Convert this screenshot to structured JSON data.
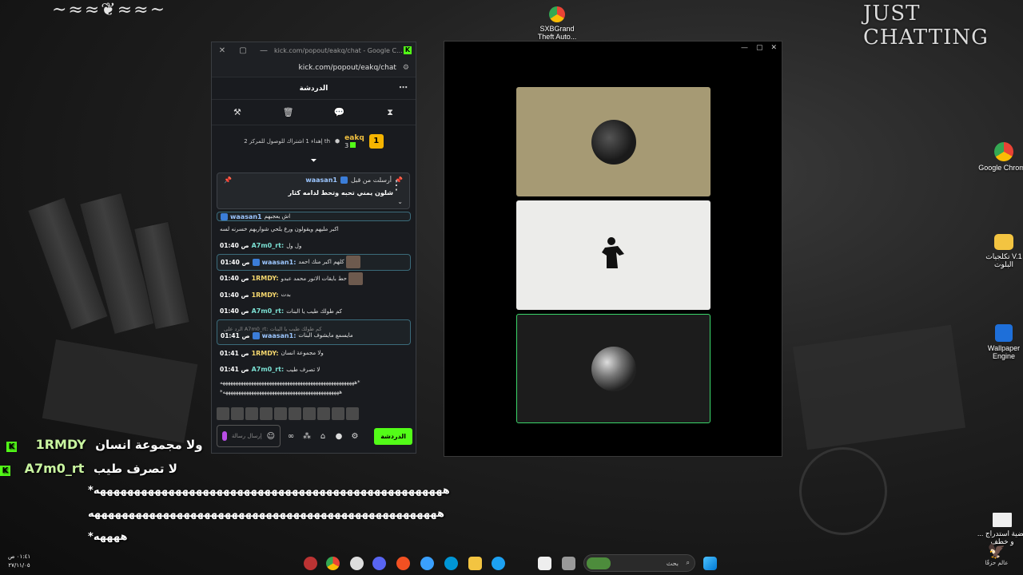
{
  "desktop": {
    "ornament": "~≈≈❦≈≈~",
    "stream_title": "JUST CHATTING",
    "icons": [
      {
        "label": "SXBGrand Theft Auto...",
        "icon": "chrome-shortcut-icon"
      },
      {
        "label": "Google Chrome",
        "icon": "chrome-icon"
      },
      {
        "label": "تكلجيات V.1 البلوت",
        "icon": "folder-icon"
      },
      {
        "label": "Wallpaper Engine",
        "icon": "wallpaper-engine-icon"
      },
      {
        "label": "قضية استدراج ... و خطف",
        "icon": "document-icon"
      }
    ],
    "corner_logo": "عالم حزقًا"
  },
  "chat_window": {
    "title": "kick.com/popout/eakq/chat - Google C...",
    "url": "kick.com/popout/eakq/chat",
    "header": "الدردشة",
    "gift": {
      "rank": "1",
      "user": "eakq",
      "count": "3",
      "text": "إهداء 1 اشتراك للوصول للمركز 2 th"
    },
    "pinned": {
      "label": "أرسلت من قبل",
      "user": "waasan1",
      "text": "شلون يمني تحبه وتحط لدامه كثار"
    },
    "messages": [
      {
        "time": "",
        "user": "waasan1",
        "user_color": "#9cc6ff",
        "text": "اش يعجبهم",
        "badge": true,
        "hl": true,
        "partial": true
      },
      {
        "time": "",
        "user": "",
        "user_color": "#ffffff",
        "text": "اكبر مليهم ويقولون ورع يلحي شواربهم خسرنه لسه",
        "badge": false,
        "hl": false
      },
      {
        "time": "01:40 ص",
        "user": "A7m0_rt:",
        "user_color": "#7be0d3",
        "text": "ول ول",
        "badge": false,
        "hl": false
      },
      {
        "time": "01:40 ص",
        "user": "waasan1:",
        "user_color": "#9cc6ff",
        "text": "كلهم اكبر منك احمد",
        "badge": true,
        "hl": true,
        "thumb": true
      },
      {
        "time": "01:40 ص",
        "user": "1RMDY:",
        "user_color": "#f5d76e",
        "text": "حط بايقات الانور محمد عبدو",
        "badge": false,
        "hl": false,
        "thumb": true
      },
      {
        "time": "01:40 ص",
        "user": "1RMDY:",
        "user_color": "#f5d76e",
        "text": "بدت",
        "badge": false,
        "hl": false
      },
      {
        "time": "01:40 ص",
        "user": "A7m0_rt:",
        "user_color": "#7be0d3",
        "text": "كم طولك طيب يا البنات",
        "badge": false,
        "hl": false
      }
    ],
    "reply": {
      "quote": "الرد على A7m0_rt: كم طولك طيب يا البنات",
      "time": "01:41 ص",
      "user": "waasan1:",
      "text": "مايسمع مايشوف البنات"
    },
    "messages2": [
      {
        "time": "01:41 ص",
        "user": "1RMDY:",
        "user_color": "#f5d76e",
        "text": "ولا مجموعة انسان"
      },
      {
        "time": "01:41 ص",
        "user": "A7m0_rt:",
        "user_color": "#7be0d3",
        "text": "لا تصرف طيب"
      }
    ],
    "spam1": "ههههههههههههههههههههههههههههههههههههههههههههههههههههه*",
    "spam2": "*هههههههههههههههههههههههههههههههههههههههههههههه",
    "input_placeholder": "إرسال رسالة",
    "send_label": "الدردشة"
  },
  "overlay": {
    "lines": [
      {
        "user": "1RMDY",
        "text": "ولا مجموعة انسان"
      },
      {
        "user": "A7m0_rt",
        "text": "لا تصرف طيب"
      }
    ],
    "spam1": "*هههههههههههههههههههههههههههههههههههههههههههههههههههه",
    "spam2": "هههههههههههههههههههههههههههههههههههههههههههههههههههه",
    "spam3": "*ههههه"
  },
  "taskbar": {
    "search_placeholder": "بحث",
    "time": "٠١:٤١ ص",
    "date": "٢٧/١١/٠٥"
  }
}
